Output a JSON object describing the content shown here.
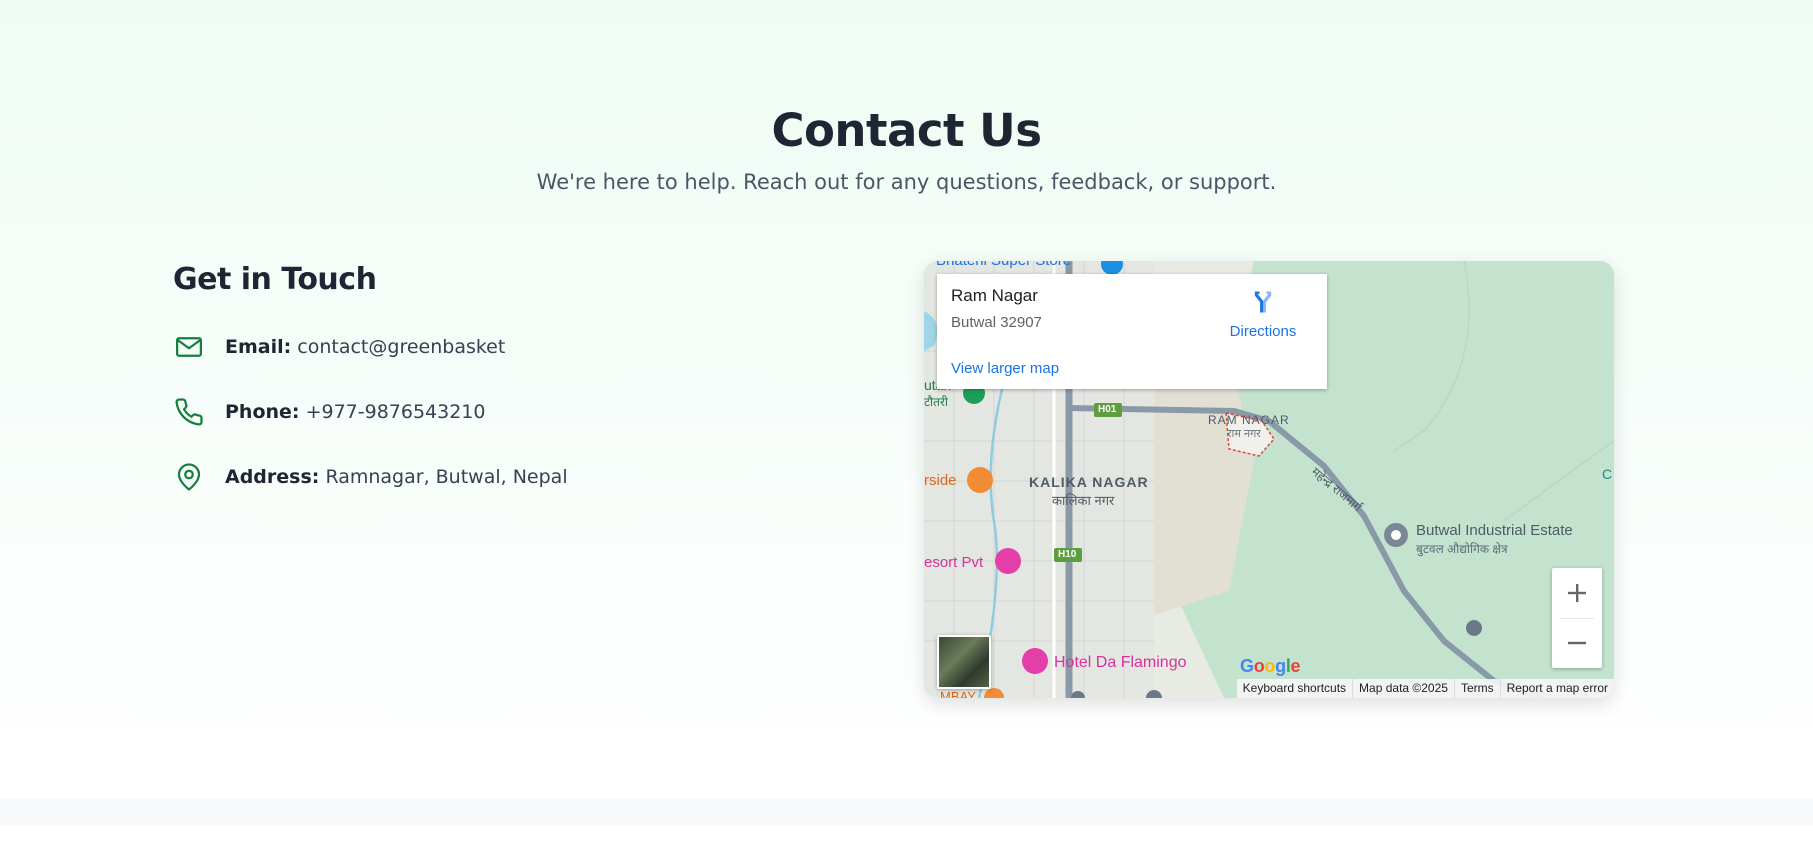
{
  "header": {
    "title": "Contact Us",
    "subtitle": "We're here to help. Reach out for any questions, feedback, or support."
  },
  "contact": {
    "heading": "Get in Touch",
    "items": [
      {
        "icon": "mail-icon",
        "label": "Email:",
        "value": "contact@greenbasket"
      },
      {
        "icon": "phone-icon",
        "label": "Phone:",
        "value": "+977-9876543210"
      },
      {
        "icon": "location-pin-icon",
        "label": "Address:",
        "value": "Ramnagar, Butwal, Nepal"
      }
    ]
  },
  "map": {
    "place_name": "Ram Nagar",
    "place_address": "Butwal 32907",
    "directions_label": "Directions",
    "larger_map_label": "View larger map",
    "zoom_in_label": "+",
    "zoom_out_label": "−",
    "labels": {
      "top_store": "Bhateni Super Store",
      "ram_nagar": "RAM NAGAR",
      "ram_nagar_np": "राम नगर",
      "kalika": "KALIKA NAGAR",
      "kalika_np": "कालिका नगर",
      "industrial": "Butwal Industrial Estate",
      "industrial_np": "बुटवल औद्योगिक क्षेत्र",
      "road_np": "महेन्द्र राजमार्ग",
      "riverside": "rside",
      "resort": "esort Pvt",
      "hotel": "Hotel Da Flamingo",
      "tan": "utan",
      "tan_np": "टौतरी",
      "h01": "H01",
      "h10": "H10",
      "edge_c": "C",
      "bottom_partial": "MBAY"
    },
    "attribution": {
      "google": "Google",
      "keyboard": "Keyboard shortcuts",
      "map_data": "Map data ©2025",
      "terms": "Terms",
      "report": "Report a map error"
    }
  },
  "colors": {
    "brand_green": "#15803d",
    "heading": "#1e2533",
    "body_text": "#374151",
    "link_blue": "#1a73e8"
  }
}
